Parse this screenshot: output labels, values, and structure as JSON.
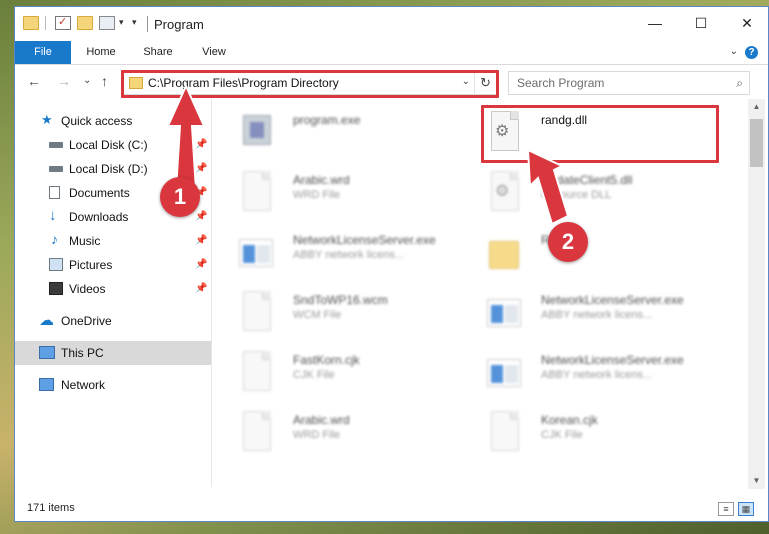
{
  "window": {
    "title": "Program",
    "minimize": "—",
    "maximize": "☐",
    "close": "✕"
  },
  "ribbon": {
    "tabs": [
      "File",
      "Home",
      "Share",
      "View"
    ],
    "help": "?"
  },
  "address": {
    "path": "C:\\Program Files\\Program Directory",
    "refresh": "↻",
    "dropdown": "⌄"
  },
  "search": {
    "placeholder": "Search Program"
  },
  "nav": {
    "back": "←",
    "forward": "→",
    "recent": "⌄",
    "up": "↑"
  },
  "sidebar": {
    "items": [
      {
        "label": "Quick access"
      },
      {
        "label": "Local Disk (C:)"
      },
      {
        "label": "Local Disk (D:)"
      },
      {
        "label": "Documents"
      },
      {
        "label": "Downloads"
      },
      {
        "label": "Music"
      },
      {
        "label": "Pictures"
      },
      {
        "label": "Videos"
      },
      {
        "label": "OneDrive"
      },
      {
        "label": "This PC"
      },
      {
        "label": "Network"
      }
    ]
  },
  "files": [
    {
      "name": "program.exe",
      "type": ""
    },
    {
      "name": "randg.dll",
      "type": ""
    },
    {
      "name": "Arabic.wrd",
      "type": "WRD File"
    },
    {
      "name": "UpdateClient5.dll",
      "type": "Resource DLL"
    },
    {
      "name": "NetworkLicenseServer.exe",
      "type": "ABBY network licens..."
    },
    {
      "name": "Re",
      "type": ""
    },
    {
      "name": "SndToWP16.wcm",
      "type": "WCM File"
    },
    {
      "name": "NetworkLicenseServer.exe",
      "type": "ABBY network licens..."
    },
    {
      "name": "FastKorn.cjk",
      "type": "CJK File"
    },
    {
      "name": "NetworkLicenseServer.exe",
      "type": "ABBY network licens..."
    },
    {
      "name": "Arabic.wrd",
      "type": "WRD File"
    },
    {
      "name": "Korean.cjk",
      "type": "CJK File"
    }
  ],
  "status": {
    "items_count": "171 items"
  },
  "annotations": {
    "step1": "1",
    "step2": "2"
  },
  "colors": {
    "accent": "#1979ca",
    "highlight_red": "#d9363e",
    "selected_bg": "#d9d9d9"
  }
}
